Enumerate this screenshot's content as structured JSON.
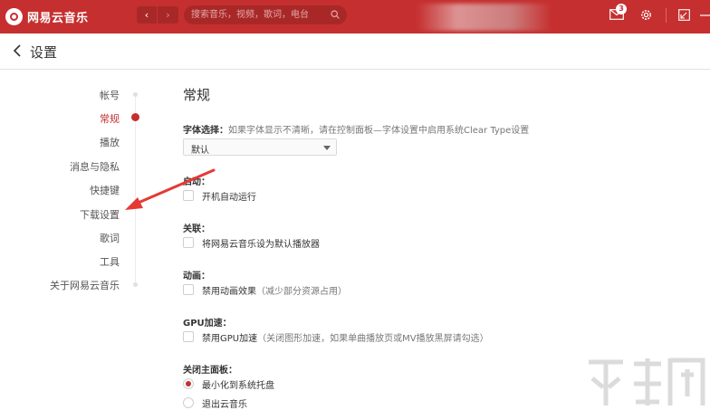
{
  "app": {
    "logo_text": "网易云音乐",
    "search_placeholder": "搜索音乐，视频，歌词，电台",
    "mail_badge": "3",
    "nav_back": "‹",
    "nav_forward": "›"
  },
  "colors": {
    "brand": "#c62f2f",
    "accent": "#c62f2f"
  },
  "page": {
    "title": "设置"
  },
  "sidebar": {
    "items": [
      {
        "label": "帐号",
        "active": false
      },
      {
        "label": "常规",
        "active": true
      },
      {
        "label": "播放",
        "active": false
      },
      {
        "label": "消息与隐私",
        "active": false
      },
      {
        "label": "快捷键",
        "active": false
      },
      {
        "label": "下载设置",
        "active": false
      },
      {
        "label": "歌词",
        "active": false
      },
      {
        "label": "工具",
        "active": false
      },
      {
        "label": "关于网易云音乐",
        "active": false
      }
    ]
  },
  "general": {
    "heading": "常规",
    "font": {
      "label": "字体选择：",
      "hint": "如果字体显示不清晰，请在控制面板—字体设置中启用系统Clear Type设置",
      "value": "默认"
    },
    "startup": {
      "label": "启动：",
      "option": "开机自动运行",
      "checked": false
    },
    "association": {
      "label": "关联：",
      "option": "将网易云音乐设为默认播放器",
      "checked": false
    },
    "animation": {
      "label": "动画：",
      "option": "禁用动画效果",
      "note": "（减少部分资源占用）",
      "checked": false
    },
    "gpu": {
      "label": "GPU加速：",
      "option": "禁用GPU加速",
      "note": "（关闭图形加速，如果单曲播放页或MV播放黑屏请勾选）",
      "checked": false
    },
    "close_panel": {
      "label": "关闭主面板：",
      "options": [
        {
          "label": "最小化到系统托盘",
          "selected": true
        },
        {
          "label": "退出云音乐",
          "selected": false
        }
      ]
    }
  }
}
